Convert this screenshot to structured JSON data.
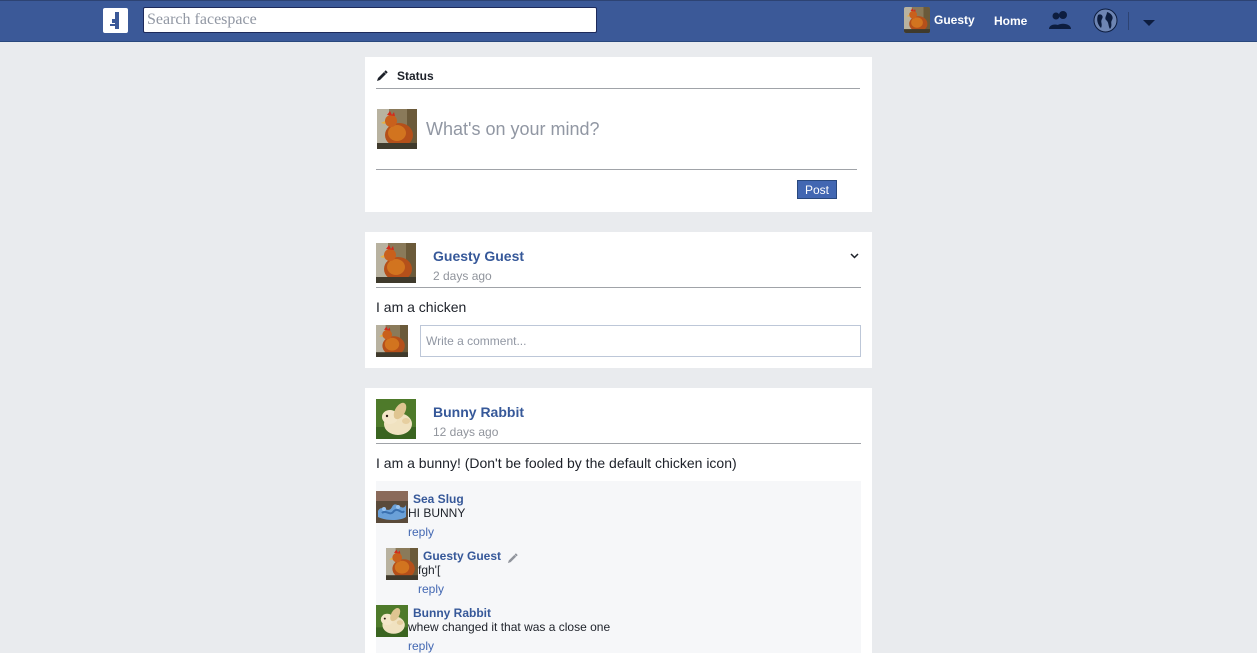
{
  "header": {
    "search_placeholder": "Search facespace",
    "user_name": "Guesty",
    "home_label": "Home",
    "icons": [
      "logo-icon",
      "friends-icon",
      "globe-icon",
      "caret-down-icon"
    ],
    "bar_color": "#3b5998"
  },
  "composer": {
    "title": "Status",
    "placeholder": "What's on your mind?",
    "post_label": "Post"
  },
  "posts": [
    {
      "author": "Guesty Guest",
      "time": "2 days ago",
      "body": "I am a chicken",
      "avatar": "chicken",
      "comment_placeholder": "Write a comment..."
    },
    {
      "author": "Bunny Rabbit",
      "time": "12 days ago",
      "body": "I am a bunny! (Don't be fooled by the default chicken icon)",
      "avatar": "bunny",
      "comments": [
        {
          "author": "Sea Slug",
          "text": "HI BUNNY",
          "reply": "reply",
          "avatar": "seaslug"
        },
        {
          "author": "Guesty Guest",
          "text": "fgh'[",
          "reply": "reply",
          "avatar": "chicken",
          "nested": true,
          "editable": true
        },
        {
          "author": "Bunny Rabbit",
          "text": "whew changed it that was a close one",
          "reply": "reply",
          "avatar": "bunny"
        }
      ]
    }
  ],
  "colors": {
    "background": "#e9ebee",
    "link": "#365899",
    "button": "#4267b2"
  }
}
